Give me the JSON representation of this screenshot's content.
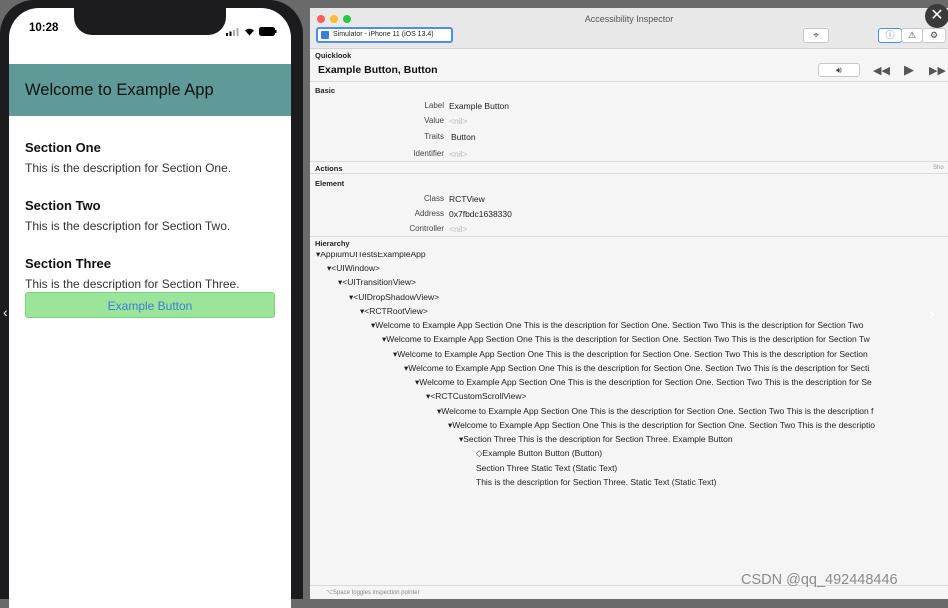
{
  "phone": {
    "status_time": "10:28",
    "header_title": "Welcome to Example App",
    "sections": [
      {
        "title": "Section One",
        "description": "This is the description for Section One."
      },
      {
        "title": "Section Two",
        "description": "This is the description for Section Two."
      },
      {
        "title": "Section Three",
        "description": "This is the description for Section Three."
      }
    ],
    "button_label": "Example Button"
  },
  "inspector": {
    "window_title": "Accessibility Inspector",
    "target": "Simulator - iPhone 11 (iOS 13.4)",
    "quicklook_label": "Quicklook",
    "quicklook_title": "Example Button, Button",
    "basic_label": "Basic",
    "basic": [
      {
        "key": "Label",
        "value": "Example Button",
        "nil": false
      },
      {
        "key": "Value",
        "value": "<nil>",
        "nil": true
      },
      {
        "key": "Traits",
        "value": "Button",
        "nil": false
      },
      {
        "key": "Identifier",
        "value": "<nil>",
        "nil": true
      }
    ],
    "actions_label": "Actions",
    "actions_right": "Sho",
    "element_label": "Element",
    "element": [
      {
        "key": "Class",
        "value": "RCTView",
        "nil": false
      },
      {
        "key": "Address",
        "value": "0x7fbdc1638330",
        "nil": false
      },
      {
        "key": "Controller",
        "value": "<nil>",
        "nil": true
      }
    ],
    "hierarchy_label": "Hierarchy",
    "hierarchy": [
      "▾AppiumUITestsExampleApp",
      "▾<UIWindow>",
      "▾<UITransitionView>",
      "▾<UIDropShadowView>",
      "▾<RCTRootView>",
      "▾Welcome to Example App Section One This is the description for Section One. Section Two This is the description for Section Two",
      "▾Welcome to Example App Section One This is the description for Section One. Section Two This is the description for Section Tw",
      "▾Welcome to Example App Section One This is the description for Section One. Section Two This is the description for Section",
      "▾Welcome to Example App Section One This is the description for Section One. Section Two This is the description for Secti",
      "▾Welcome to Example App Section One This is the description for Section One. Section Two This is the description for Se",
      "▾<RCTCustomScrollView>",
      "▾Welcome to Example App Section One This is the description for Section One. Section Two This is the description f",
      "▾Welcome to Example App Section One This is the description for Section One. Section Two This is the descriptio",
      "▾Section Three This is the description for Section Three. Example Button",
      "◇Example Button Button (Button)",
      "Section Three Static Text (Static Text)",
      "This is the description for Section Three. Static Text (Static Text)"
    ],
    "footer": "⌥Space toggles inspection pointer"
  },
  "watermark": "CSDN @qq_492448446",
  "colors": {
    "header_bg": "#5f9a99",
    "button_bg": "#9be59a",
    "button_text": "#3a7fd6",
    "selection_border": "#4a8ef0"
  }
}
